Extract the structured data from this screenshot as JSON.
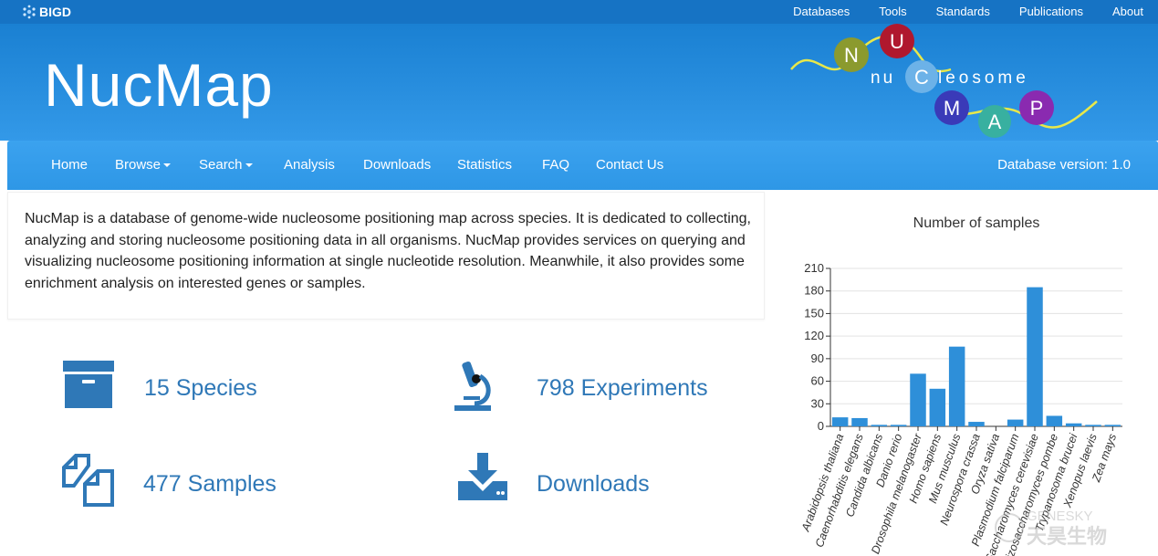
{
  "topbar": {
    "brand": "BIGD",
    "links": [
      "Databases",
      "Tools",
      "Standards",
      "Publications",
      "About"
    ]
  },
  "header": {
    "title": "NucMap",
    "logo_text": {
      "n": "N",
      "u": "U",
      "c": "C",
      "m": "M",
      "a": "A",
      "p": "P",
      "middle1": "nu",
      "middle2": "leosome"
    }
  },
  "nav": {
    "items": [
      "Home",
      "Browse",
      "Search",
      "Analysis",
      "Downloads",
      "Statistics",
      "FAQ",
      "Contact Us"
    ],
    "version": "Database version: 1.0"
  },
  "intro": {
    "text": "NucMap is a database of genome-wide nucleosome positioning map across species. It is dedicated to collecting, analyzing and storing nucleosome positioning data in all organisms. NucMap provides services on querying and visualizing nucleosome positioning information at single nucleotide resolution. Meanwhile, it also provides some enrichment analysis on interested genes or samples."
  },
  "stats": {
    "species": "15 Species",
    "experiments": "798 Experiments",
    "samples": "477 Samples",
    "downloads": "Downloads"
  },
  "watermark": {
    "line1": "GENESKY",
    "line2": "天昊生物"
  },
  "colors": {
    "topbar": "#1673c4",
    "header": "#2a8fe0",
    "accent": "#2f78b7",
    "bar": "#2e8fd9"
  },
  "chart_data": {
    "type": "bar",
    "title": "Number of samples",
    "categories": [
      "Arabidopsis thaliana",
      "Caenorhabditis elegans",
      "Candida albicans",
      "Danio rerio",
      "Drosophila melanogaster",
      "Homo sapiens",
      "Mus musculus",
      "Neurospora crassa",
      "Oryza sativa",
      "Plasmodium falciparum",
      "Saccharomyces cerevisiae",
      "Schizosaccharomyces pombe",
      "Trypanosoma brucei",
      "Xenopus laevis",
      "Zea mays"
    ],
    "values": [
      12,
      11,
      2,
      2,
      70,
      50,
      106,
      6,
      0,
      9,
      185,
      14,
      4,
      2,
      2
    ],
    "yticks": [
      0,
      30,
      60,
      90,
      120,
      150,
      180,
      210
    ],
    "ylim": [
      0,
      210
    ],
    "xlabel": "",
    "ylabel": "",
    "grid": true
  }
}
